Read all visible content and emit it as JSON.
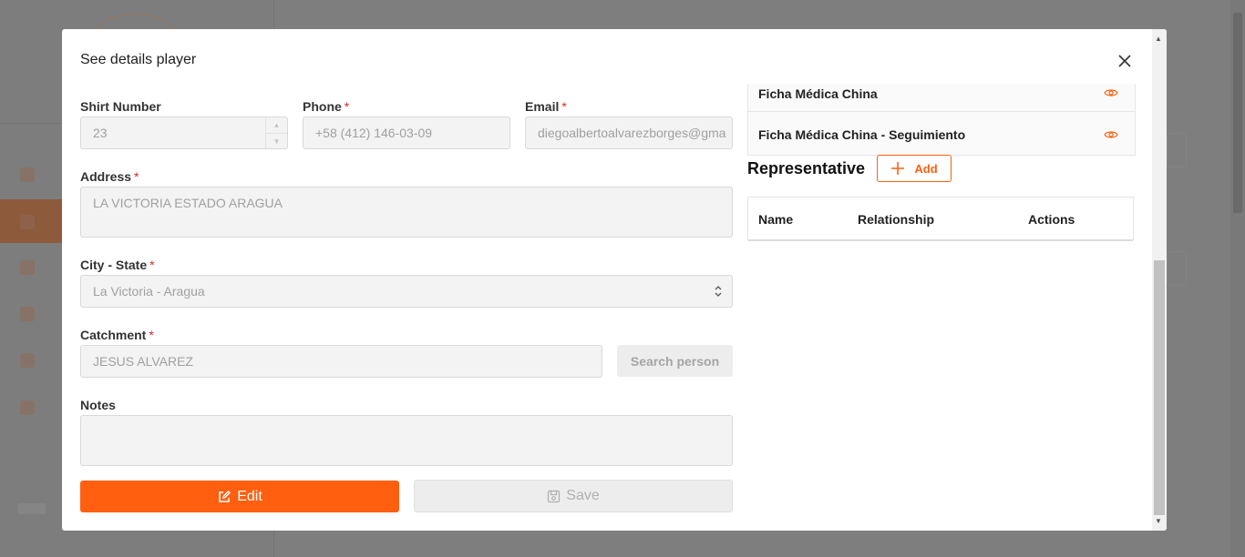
{
  "modal": {
    "title": "See details player",
    "form": {
      "shirt_number": {
        "label": "Shirt Number",
        "value": "23"
      },
      "phone": {
        "label": "Phone",
        "value": "+58 (412) 146-03-09"
      },
      "email": {
        "label": "Email",
        "value": "diegoalbertoalvarezborges@gma"
      },
      "address": {
        "label": "Address",
        "value": "LA VICTORIA ESTADO ARAGUA"
      },
      "city_state": {
        "label": "City - State",
        "value": "La Victoria - Aragua"
      },
      "catchment": {
        "label": "Catchment",
        "value": "JESUS  ALVAREZ"
      },
      "notes": {
        "label": "Notes",
        "value": ""
      },
      "required_mark": "*"
    },
    "buttons": {
      "search_person": "Search person",
      "edit": "Edit",
      "save": "Save"
    },
    "documents": [
      {
        "name": "Ficha Médica China"
      },
      {
        "name": "Ficha Médica China - Seguimiento"
      }
    ],
    "representative": {
      "title": "Representative",
      "add_label": "Add",
      "columns": [
        "Name",
        "Relationship",
        "Actions"
      ]
    }
  },
  "colors": {
    "accent": "#ff5f0f",
    "required": "#e02424"
  }
}
